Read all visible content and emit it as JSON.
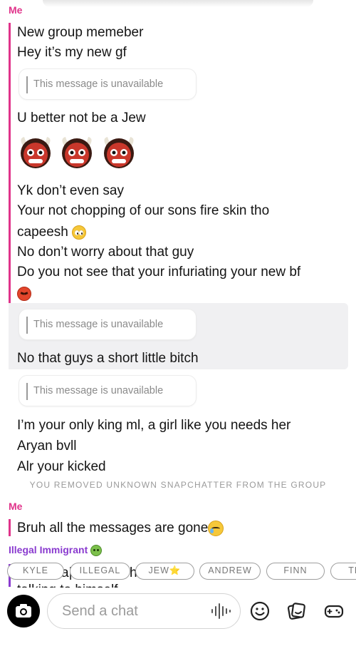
{
  "conversation": {
    "sender_me": "Me",
    "sender_other": "Illegal Immigrant",
    "unavailable_text": "This message is unavailable",
    "messages": {
      "m1": "New group memeber",
      "m2": "Hey it’s my new gf",
      "m3": "U better not be a Jew",
      "m4": "Yk don’t even say",
      "m5": "Your not chopping of our sons fire skin tho",
      "m6": "capeesh",
      "m7": "No don’t worry about that guy",
      "m8": "Do you not see that your infuriating your new bf",
      "m9": "No that guys a short little bitch",
      "m10": "I’m your only king ml, a girl like you needs her",
      "m11": "Aryan bvll",
      "m12": "Alr your kicked",
      "m13": "Bruh all the messages are gone"
    },
    "system_notice": "YOU REMOVED UNKNOWN SNAPCHATTER FROM THE GROUP",
    "partial_under_chips": "h",
    "partial_under_chips_left": "a|",
    "partial_cut_line": "talking to himself"
  },
  "mention_chips": [
    "KYLE",
    "ILLEGAL",
    "JEW⭐",
    "ANDREW",
    "FINN",
    "THO"
  ],
  "composer": {
    "placeholder": "Send a chat"
  },
  "icons": {
    "camera": "camera-icon",
    "voice": "voice-waveform-icon",
    "emoji": "emoji-smiley-icon",
    "sticker": "sticker-icon",
    "games": "game-controller-icon",
    "ogre": "japanese-ogre-emoji",
    "pleading": "pleading-face-emoji",
    "angry": "angry-face-emoji",
    "tear": "smiling-face-with-tear-emoji",
    "sick": "nauseated-face-emoji"
  },
  "colors": {
    "me": "#e0338a",
    "other": "#8a3bcf",
    "highlight": "#f0f0f2",
    "muted": "#9a9a9a"
  }
}
